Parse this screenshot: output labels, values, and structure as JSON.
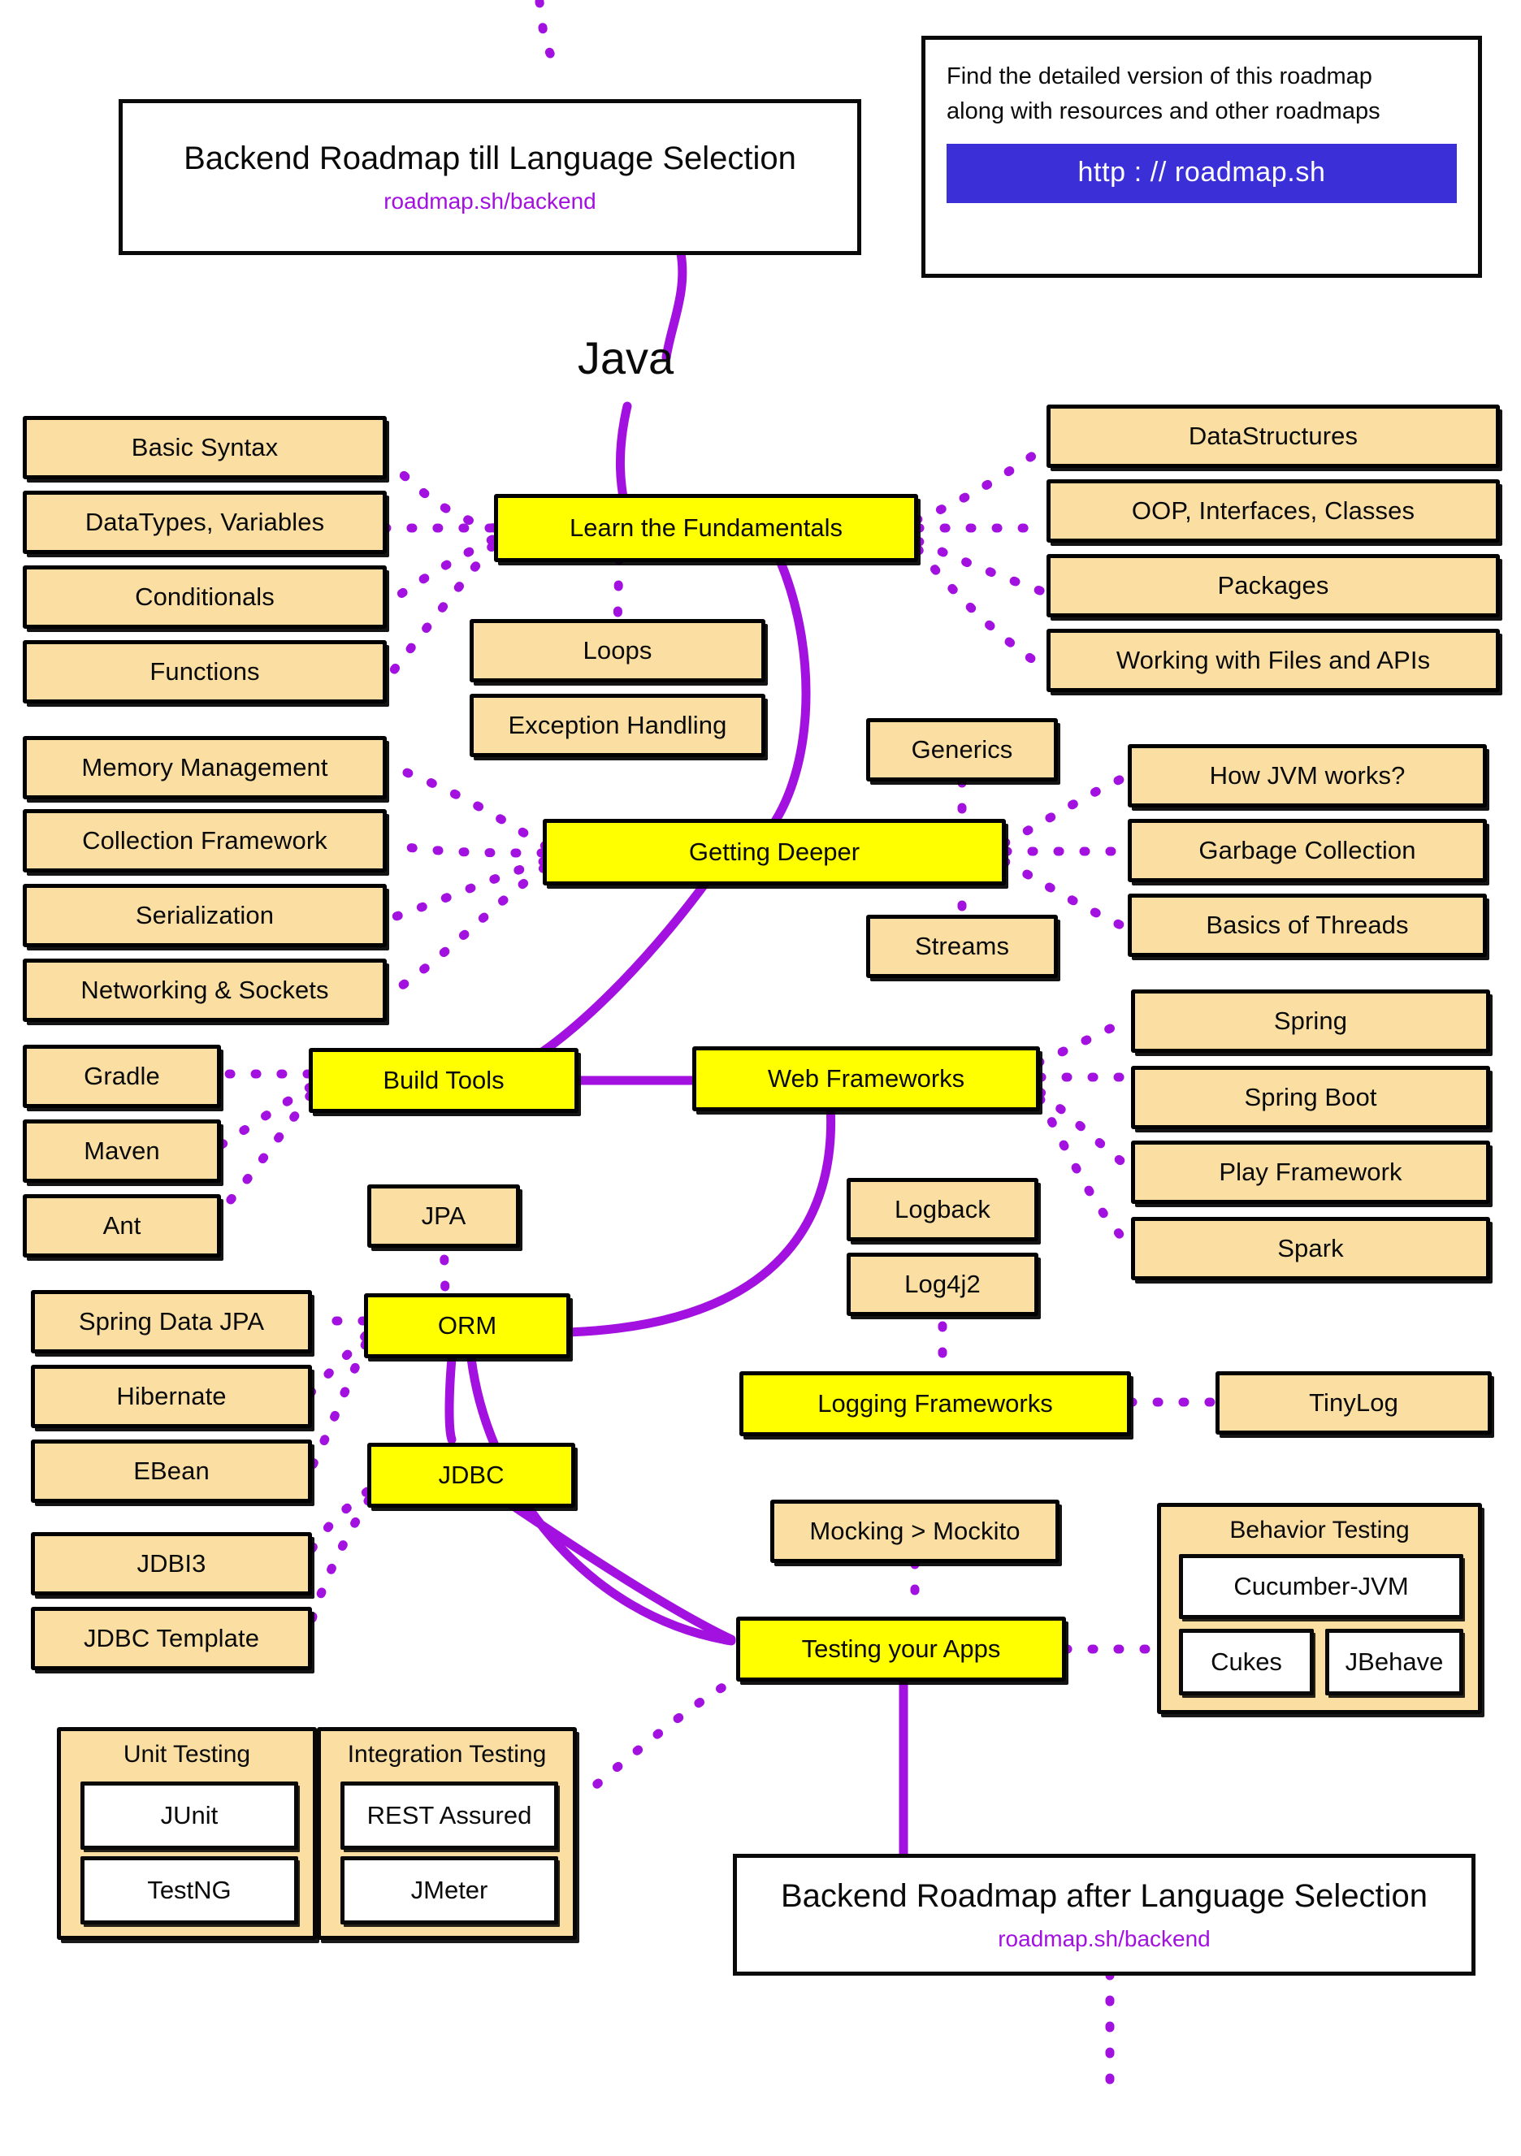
{
  "colors": {
    "accent_purple": "#a211e0",
    "topic_fill": "#fbdfa2",
    "primary_fill": "#ffff00",
    "url_button": "#3b30d8",
    "outline": "#0a0a0a"
  },
  "header": {
    "title": "Backend Roadmap till Language Selection",
    "subtitle": "roadmap.sh/backend"
  },
  "info": {
    "line1": "Find the detailed version of this roadmap",
    "line2": "along with resources and other roadmaps",
    "url_label": "http : // roadmap.sh"
  },
  "language_label": "Java",
  "sections": {
    "fundamentals": {
      "label": "Learn the Fundamentals",
      "left": [
        "Basic Syntax",
        "DataTypes, Variables",
        "Conditionals",
        "Functions"
      ],
      "below": [
        "Loops",
        "Exception Handling"
      ],
      "right": [
        "DataStructures",
        "OOP, Interfaces, Classes",
        "Packages",
        "Working with Files and APIs"
      ]
    },
    "getting_deeper": {
      "label": "Getting Deeper",
      "left": [
        "Memory Management",
        "Collection Framework",
        "Serialization",
        "Networking & Sockets"
      ],
      "above": "Generics",
      "below": "Streams",
      "right": [
        "How JVM works?",
        "Garbage Collection",
        "Basics of Threads"
      ]
    },
    "build_tools": {
      "label": "Build Tools",
      "left": [
        "Gradle",
        "Maven",
        "Ant"
      ]
    },
    "web_frameworks": {
      "label": "Web Frameworks",
      "right": [
        "Spring",
        "Spring Boot",
        "Play Framework",
        "Spark"
      ]
    },
    "orm": {
      "label": "ORM",
      "above": "JPA",
      "left": [
        "Spring Data JPA",
        "Hibernate",
        "EBean"
      ]
    },
    "jdbc": {
      "label": "JDBC",
      "left": [
        "JDBI3",
        "JDBC Template"
      ]
    },
    "logging": {
      "label": "Logging Frameworks",
      "above": [
        "Logback",
        "Log4j2"
      ],
      "right": "TinyLog"
    },
    "testing": {
      "label": "Testing your Apps",
      "above": "Mocking  >  Mockito",
      "groups": [
        {
          "title": "Unit Testing",
          "items": [
            "JUnit",
            "TestNG"
          ]
        },
        {
          "title": "Integration Testing",
          "items": [
            "REST Assured",
            "JMeter"
          ]
        },
        {
          "title": "Behavior Testing",
          "items": [
            "Cucumber-JVM",
            "Cukes",
            "JBehave"
          ]
        }
      ]
    }
  },
  "footer": {
    "title": "Backend Roadmap after Language Selection",
    "subtitle": "roadmap.sh/backend"
  }
}
